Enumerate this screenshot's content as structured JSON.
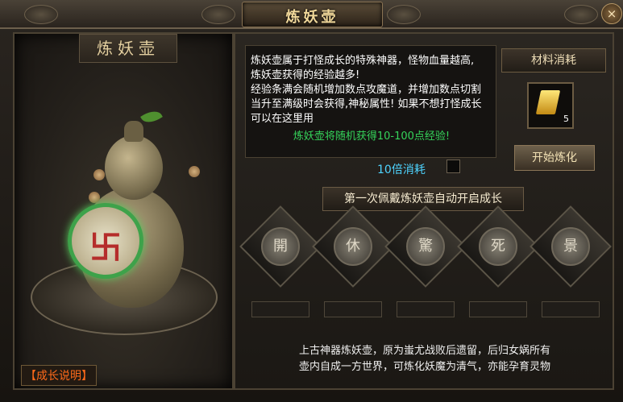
{
  "window": {
    "title": "炼妖壶"
  },
  "left_panel": {
    "title": "炼妖壶",
    "help_link": "【成长说明】"
  },
  "info": {
    "lines": [
      "炼妖壶属于打怪成长的特殊神器，怪物血量越高,",
      "炼妖壶获得的经验越多!",
      "经验条满会随机增加数点攻魔道，并增加数点切割",
      "当升至满级时会获得,神秘属性! 如果不想打怪成长",
      "可以在这里用"
    ],
    "highlight": "炼妖壶将随机获得10-100点经验!"
  },
  "materials": {
    "title": "材料消耗",
    "count": "5"
  },
  "actions": {
    "start_label": "开始炼化",
    "tenx_label": "10倍消耗"
  },
  "growth_banner": "第一次佩戴炼妖壶自动开启成长",
  "slots": [
    "開",
    "休",
    "驚",
    "死",
    "景"
  ],
  "lore": [
    "上古神器炼妖壶，原为蚩尤战败后遗留，后归女娲所有",
    "壶内自成一方世界，可炼化妖魔为清气，亦能孕育灵物"
  ],
  "colors": {
    "accent_gold": "#f1d89a",
    "text_green": "#35d35a",
    "text_cyan": "#4ed4ff",
    "link_orange": "#ff6a1a"
  }
}
